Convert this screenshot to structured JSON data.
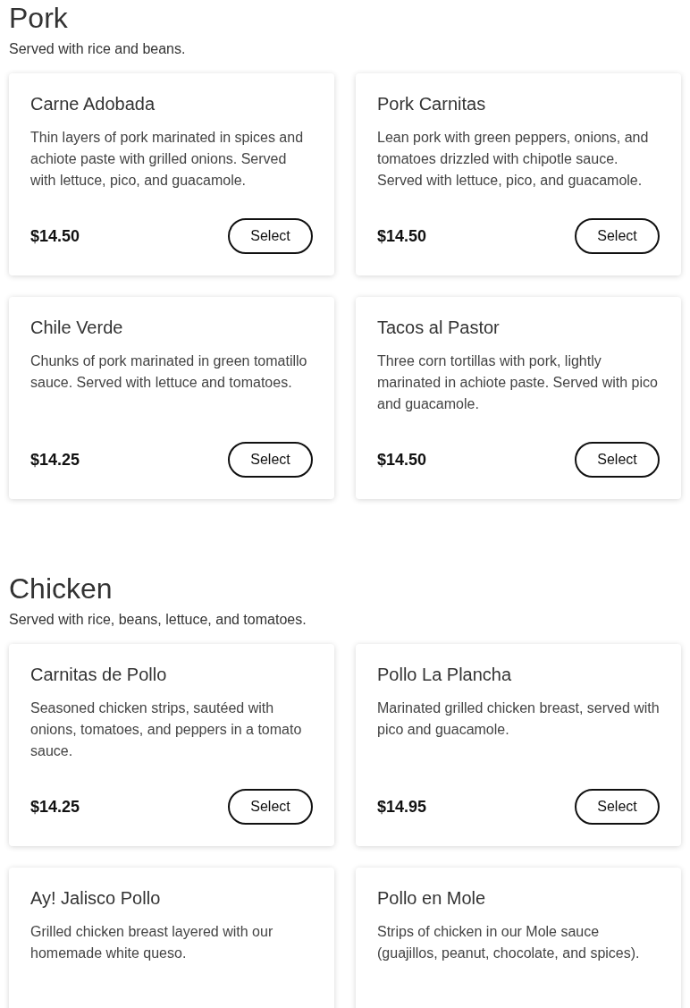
{
  "sections": [
    {
      "title": "Pork",
      "subtitle": "Served with rice and beans.",
      "items": [
        {
          "name": "Carne Adobada",
          "description": "Thin layers of pork marinated in spices and achiote paste with grilled onions. Served with lettuce, pico, and guacamole.",
          "price": "$14.50",
          "button": "Select"
        },
        {
          "name": "Pork Carnitas",
          "description": "Lean pork with green peppers, onions, and tomatoes drizzled with chipotle sauce. Served with lettuce, pico, and guacamole.",
          "price": "$14.50",
          "button": "Select"
        },
        {
          "name": "Chile Verde",
          "description": "Chunks of pork marinated in green tomatillo sauce. Served with lettuce and tomatoes.",
          "price": "$14.25",
          "button": "Select"
        },
        {
          "name": "Tacos al Pastor",
          "description": "Three corn tortillas with pork, lightly marinated in achiote paste. Served with pico and guacamole.",
          "price": "$14.50",
          "button": "Select"
        }
      ]
    },
    {
      "title": "Chicken",
      "subtitle": "Served with rice, beans, lettuce, and tomatoes.",
      "items": [
        {
          "name": "Carnitas de Pollo",
          "description": "Seasoned chicken strips, sautéed with onions, tomatoes, and peppers in a tomato sauce.",
          "price": "$14.25",
          "button": "Select"
        },
        {
          "name": "Pollo La Plancha",
          "description": "Marinated grilled chicken breast, served with pico and guacamole.",
          "price": "$14.95",
          "button": "Select"
        },
        {
          "name": "Ay! Jalisco Pollo",
          "description": "Grilled chicken breast layered with our homemade white queso."
        },
        {
          "name": "Pollo en Mole",
          "description": "Strips of chicken in our Mole sauce (guajillos, peanut, chocolate, and spices)."
        }
      ]
    }
  ]
}
